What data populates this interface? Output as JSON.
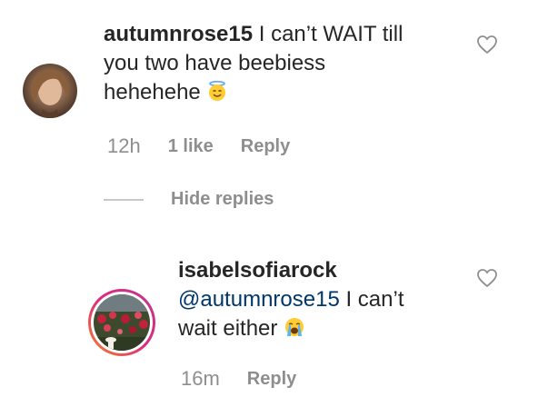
{
  "comments": [
    {
      "username": "autumnrose15",
      "text_line1": "I can’t WAIT till",
      "text_line2": "you two have beebiess",
      "text_line3": "hehehehe",
      "emoji": "smiling-face-with-halo",
      "time": "12h",
      "likes": "1 like",
      "reply": "Reply",
      "avatar": "woman-portrait"
    },
    {
      "username": "isabelsofiarock",
      "mention": "@autumnrose15",
      "text_line1_rest": "I can’t",
      "text_line2": "wait either",
      "emoji": "loudly-crying-face",
      "time": "16m",
      "reply": "Reply",
      "avatar": "flower-garden-story-ring"
    }
  ],
  "hide_replies": "Hide replies",
  "colors": {
    "text": "#262626",
    "secondary": "#8e8e8e",
    "mention": "#00376b",
    "story_ring_start": "#f58529",
    "story_ring_end": "#dd2a7b"
  }
}
